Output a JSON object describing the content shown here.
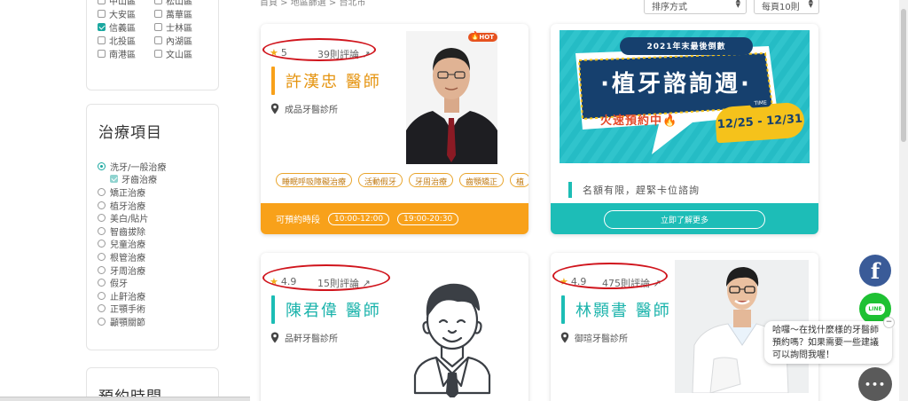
{
  "breadcrumb": "首頁 > 地區篩選 > 台北市",
  "sort": {
    "label": "排序方式"
  },
  "per_page": {
    "label": "每頁10則"
  },
  "districts": [
    {
      "label": "中山區",
      "checked": false
    },
    {
      "label": "松山區",
      "checked": false
    },
    {
      "label": "大安區",
      "checked": false
    },
    {
      "label": "萬華區",
      "checked": false
    },
    {
      "label": "信義區",
      "checked": true
    },
    {
      "label": "士林區",
      "checked": false
    },
    {
      "label": "北投區",
      "checked": false
    },
    {
      "label": "內湖區",
      "checked": false
    },
    {
      "label": "南港區",
      "checked": false
    },
    {
      "label": "文山區",
      "checked": false
    }
  ],
  "treatment": {
    "title": "治療項目",
    "items": [
      {
        "label": "洗牙/一般治療",
        "type": "radio",
        "checked": true
      },
      {
        "label": "牙齒治療",
        "type": "sub",
        "checked": true
      },
      {
        "label": "矯正治療",
        "type": "radio",
        "checked": false
      },
      {
        "label": "植牙治療",
        "type": "radio",
        "checked": false
      },
      {
        "label": "美白/貼片",
        "type": "radio",
        "checked": false
      },
      {
        "label": "智齒拔除",
        "type": "radio",
        "checked": false
      },
      {
        "label": "兒童治療",
        "type": "radio",
        "checked": false
      },
      {
        "label": "根管治療",
        "type": "radio",
        "checked": false
      },
      {
        "label": "牙周治療",
        "type": "radio",
        "checked": false
      },
      {
        "label": "假牙",
        "type": "radio",
        "checked": false
      },
      {
        "label": "止鼾治療",
        "type": "radio",
        "checked": false
      },
      {
        "label": "正顎手術",
        "type": "radio",
        "checked": false
      },
      {
        "label": "顳顎關節",
        "type": "radio",
        "checked": false
      }
    ]
  },
  "booking": {
    "title": "預約時間"
  },
  "doctors": [
    {
      "rating": "5",
      "reviews": "39則評論",
      "name": "許漢忠 醫師",
      "clinic": "成品牙醫診所",
      "badge": "HOT",
      "tags": [
        "睡眠呼吸障礙治療",
        "活動假牙",
        "牙周治療",
        "齒顎矯正",
        "植"
      ],
      "available_label": "可預約時段",
      "times": [
        "10:00-12:00",
        "19:00-20:30"
      ],
      "accent": "#f8a11a"
    },
    {
      "rating": "4.9",
      "reviews": "15則評論",
      "name": "陳君偉 醫師",
      "clinic": "品軒牙醫診所",
      "accent": "#1cbdb5"
    },
    {
      "rating": "4.9",
      "reviews": "475則評論",
      "name": "林顥書 醫師",
      "clinic": "御瑄牙醫診所",
      "accent": "#1cbdb5"
    }
  ],
  "ad": {
    "year_line": "2021年末最後倒數",
    "title": "·植牙諮詢週·",
    "cta": "火速預約中",
    "time_label": "TIME",
    "dates": "12/25 - 12/31",
    "note": "名額有限，趕緊卡位諮詢",
    "button": "立即了解更多"
  },
  "widgets": {
    "facebook": "f",
    "line": "LINE",
    "chat_text": "哈囉～在找什麼樣的牙醫師預約嗎？如果需要一些建議可以詢問我喔！",
    "chat_close": "−",
    "chat_button": "•••"
  }
}
